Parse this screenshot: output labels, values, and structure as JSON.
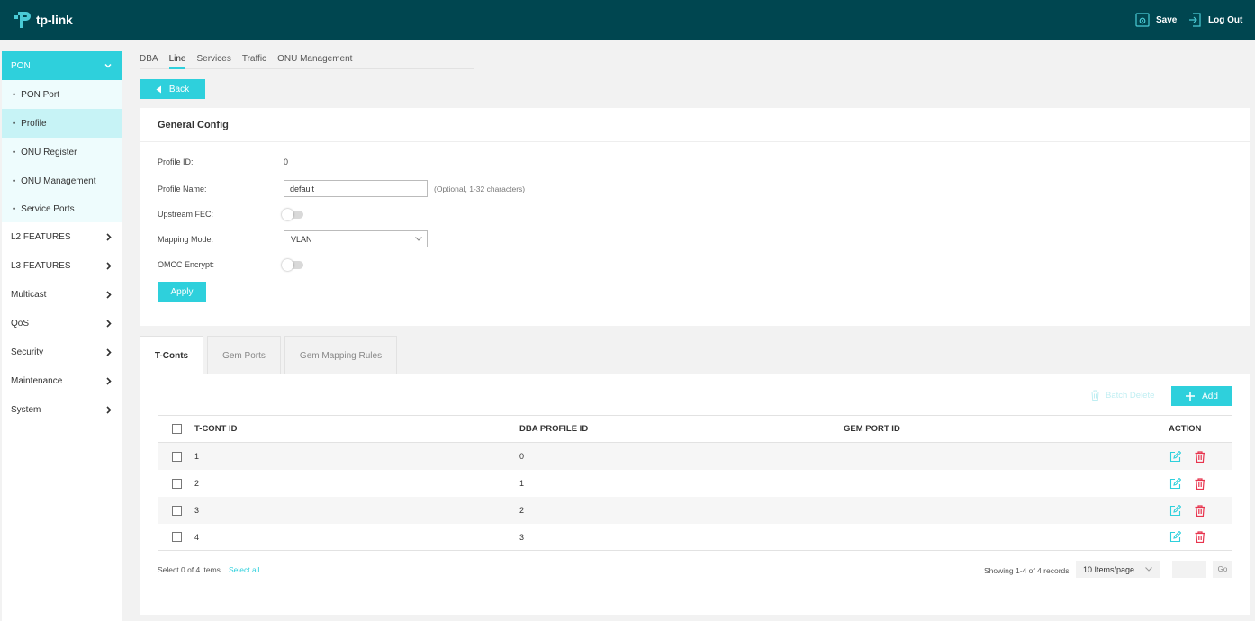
{
  "header": {
    "logo_text": "tp-link",
    "save_label": "Save",
    "logout_label": "Log Out"
  },
  "sidebar": {
    "section": "PON",
    "sub_items": [
      {
        "label": "PON Port"
      },
      {
        "label": "Profile"
      },
      {
        "label": "ONU Register"
      },
      {
        "label": "ONU Management"
      },
      {
        "label": "Service Ports"
      }
    ],
    "items": [
      {
        "label": "L2 FEATURES"
      },
      {
        "label": "L3 FEATURES"
      },
      {
        "label": "Multicast"
      },
      {
        "label": "QoS"
      },
      {
        "label": "Security"
      },
      {
        "label": "Maintenance"
      },
      {
        "label": "System"
      }
    ]
  },
  "top_tabs": [
    "DBA",
    "Line",
    "Services",
    "Traffic",
    "ONU Management"
  ],
  "active_top_tab": "Line",
  "back_label": "Back",
  "general_config": {
    "title": "General Config",
    "profile_id_label": "Profile ID:",
    "profile_id_value": "0",
    "profile_name_label": "Profile Name:",
    "profile_name_value": "default",
    "profile_name_hint": "(Optional, 1-32 characters)",
    "upstream_fec_label": "Upstream FEC:",
    "upstream_fec_on": false,
    "mapping_mode_label": "Mapping Mode:",
    "mapping_mode_value": "VLAN",
    "omcc_encrypt_label": "OMCC Encrypt:",
    "omcc_encrypt_on": false,
    "apply_label": "Apply"
  },
  "sub_tabs": [
    "T-Conts",
    "Gem Ports",
    "Gem Mapping Rules"
  ],
  "active_sub_tab": "T-Conts",
  "toolbar": {
    "batch_delete_label": "Batch Delete",
    "add_label": "Add"
  },
  "table": {
    "columns": [
      "T-CONT ID",
      "DBA PROFILE ID",
      "GEM PORT ID",
      "ACTION"
    ],
    "rows": [
      {
        "tcont_id": "1",
        "dba_profile_id": "0",
        "gem_port_id": ""
      },
      {
        "tcont_id": "2",
        "dba_profile_id": "1",
        "gem_port_id": ""
      },
      {
        "tcont_id": "3",
        "dba_profile_id": "2",
        "gem_port_id": ""
      },
      {
        "tcont_id": "4",
        "dba_profile_id": "3",
        "gem_port_id": ""
      }
    ]
  },
  "footer": {
    "select_count": "Select 0 of 4 items",
    "select_all": "Select all",
    "showing": "Showing 1-4 of 4 records",
    "per_page": "10 Items/page",
    "go": "Go"
  },
  "colors": {
    "header_bg": "#004650",
    "accent": "#2ed0dc",
    "delete_red": "#e8344e"
  }
}
